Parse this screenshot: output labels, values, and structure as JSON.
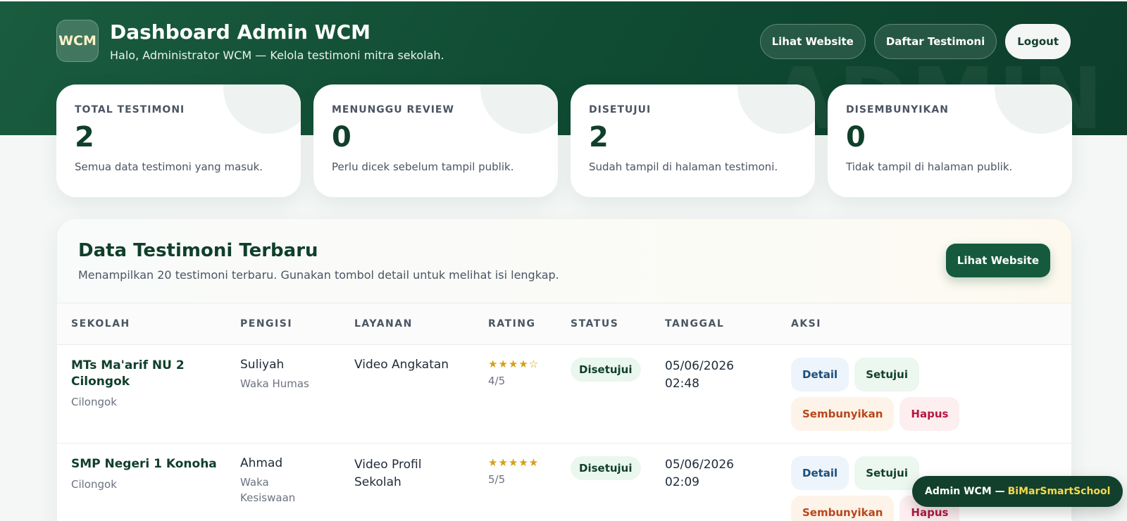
{
  "header": {
    "logo_text": "WCM",
    "title": "Dashboard Admin WCM",
    "subtitle": "Halo, Administrator WCM — Kelola testimoni mitra sekolah.",
    "watermark": "ADMIN",
    "nav": {
      "view_website": "Lihat Website",
      "testimonials": "Daftar Testimoni",
      "logout": "Logout"
    }
  },
  "stats": [
    {
      "label": "TOTAL TESTIMONI",
      "value": "2",
      "desc": "Semua data testimoni yang masuk."
    },
    {
      "label": "MENUNGGU REVIEW",
      "value": "0",
      "desc": "Perlu dicek sebelum tampil publik."
    },
    {
      "label": "DISETUJUI",
      "value": "2",
      "desc": "Sudah tampil di halaman testimoni."
    },
    {
      "label": "DISEMBUNYIKAN",
      "value": "0",
      "desc": "Tidak tampil di halaman publik."
    }
  ],
  "panel": {
    "title": "Data Testimoni Terbaru",
    "desc": "Menampilkan 20 testimoni terbaru. Gunakan tombol detail untuk melihat isi lengkap.",
    "button": "Lihat Website"
  },
  "table": {
    "columns": [
      "SEKOLAH",
      "PENGISI",
      "LAYANAN",
      "RATING",
      "STATUS",
      "TANGGAL",
      "AKSI"
    ],
    "action_labels": {
      "detail": "Detail",
      "approve": "Setujui",
      "hide": "Sembunyikan",
      "delete": "Hapus"
    },
    "rows": [
      {
        "school": "MTs Ma'arif NU 2 Cilongok",
        "location": "Cilongok",
        "name": "Suliyah",
        "role": "Waka Humas",
        "service": "Video Angkatan",
        "stars": "★★★★☆",
        "rating": "4/5",
        "status": "Disetujui",
        "date": "05/06/2026",
        "time": "02:48"
      },
      {
        "school": "SMP Negeri 1 Konoha",
        "location": "Cilongok",
        "name": "Ahmad",
        "role": "Waka Kesiswaan",
        "service": "Video Profil Sekolah",
        "stars": "★★★★★",
        "rating": "5/5",
        "status": "Disetujui",
        "date": "05/06/2026",
        "time": "02:09"
      }
    ]
  },
  "toast": {
    "prefix": "Admin WCM —",
    "brand": "BiMarSmartSchool"
  },
  "colors": {
    "primary": "#155a3d",
    "dark": "#103f2b",
    "star": "#d4a017",
    "toast_accent": "#f7d94c"
  }
}
